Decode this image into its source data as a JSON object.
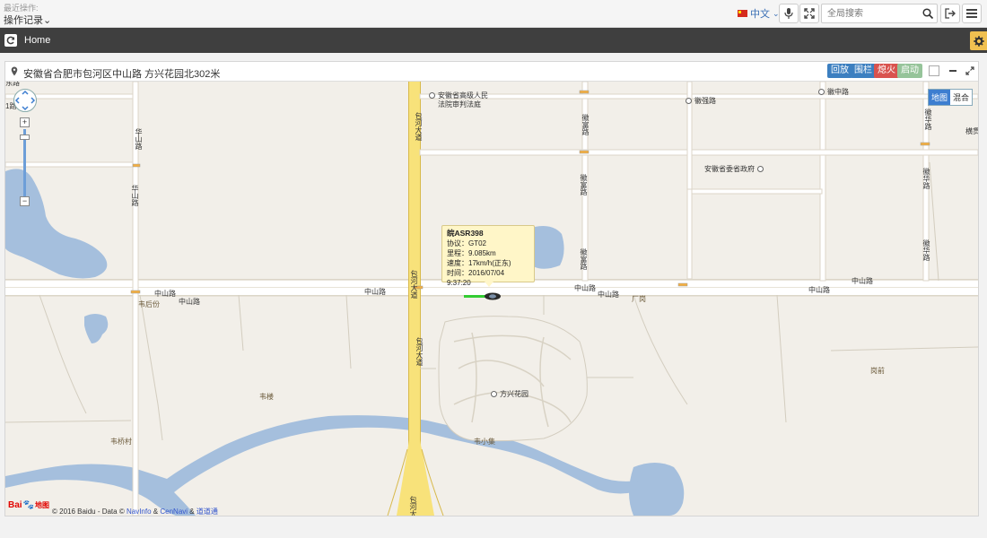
{
  "topbar": {
    "recent_label": "最近操作:",
    "recent_dropdown": "操作记录",
    "language": "中文",
    "search_placeholder": "全局搜索"
  },
  "navbar": {
    "home_label": "Home"
  },
  "panel": {
    "address": "安徽省合肥市包河区中山路 方兴花园北302米",
    "actions": [
      {
        "label": "回放",
        "color": "#3c7fc0"
      },
      {
        "label": "围栏",
        "color": "#3c7fc0"
      },
      {
        "label": "熄火",
        "color": "#d9534f"
      },
      {
        "label": "启动",
        "color": "#96c49a"
      }
    ]
  },
  "map": {
    "map_types": [
      "地图",
      "混合"
    ],
    "popup": {
      "plate": "皖ASR398",
      "protocol": "协议：GT02",
      "mileage": "里程：9.085km",
      "speed": "速度：17km/h(正东)",
      "time": "时间：2016/07/04 9:37:20"
    },
    "pois": {
      "court": "安徽省高级人民",
      "court2": "法院审判法庭",
      "huiqiang": "徽强路",
      "huizhong": "徽中路",
      "gov": "安徽省委省政府",
      "fangxing": "方兴花园",
      "hengfeng": "横贯"
    },
    "roads": {
      "zhongshan1": "中山路",
      "zhongshan2": "中山路",
      "zhongshan3": "中山路",
      "zhongshan4": "中山路",
      "zhongshan5": "中山路",
      "zhongshan6": "中山路",
      "huashan1": "华山路",
      "huashan2": "华山路",
      "baohe1": "包河大道",
      "baohe2": "包河大道",
      "baohe3": "包河大道",
      "baohe4": "包河大道",
      "huifu1": "徽富路",
      "huifu2": "徽富路",
      "huifu3": "徽富路",
      "huihua1": "徽华路",
      "huihua2": "徽华路",
      "huihua3": "徽华路"
    },
    "places": {
      "weihoufen": "韦后份",
      "weilou": "韦楼",
      "weiqiaocun": "韦桥村",
      "weixiaoji": "韦小集",
      "changgang": "厂岗",
      "gangqian": "岗前",
      "partial_left_top": "东路",
      "partial_left": "1路"
    },
    "copyright": {
      "prefix": "© 2016 Baidu - Data ©",
      "navinfo": "NavInfo",
      "amp1": "&",
      "cennavi": "CenNavi",
      "amp2": "&",
      "daodao": "道道通"
    },
    "logo": {
      "bai": "Bai",
      "paw": "du",
      "du": "地图"
    }
  }
}
